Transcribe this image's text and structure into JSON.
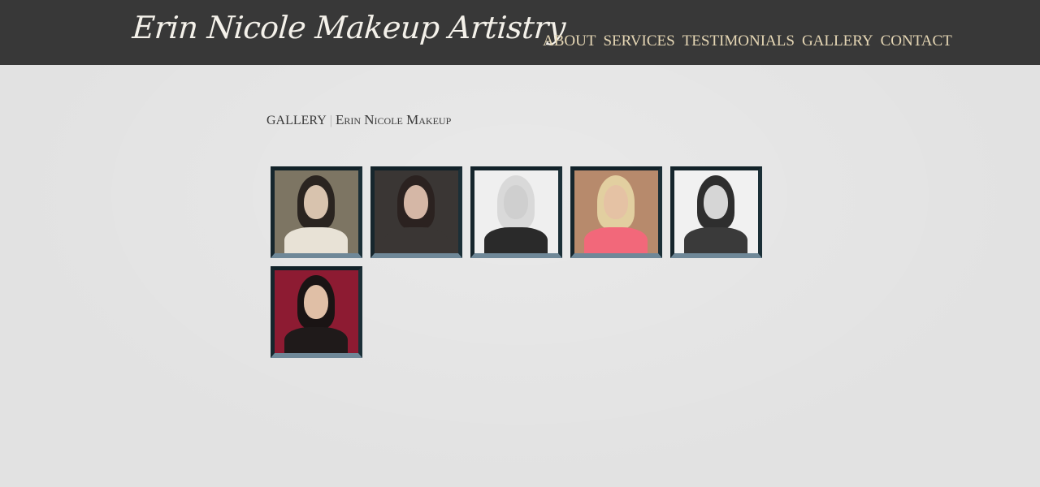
{
  "header": {
    "logo_text": "Erin Nicole Makeup Artistry",
    "nav": [
      {
        "label": "ABOUT"
      },
      {
        "label": "SERVICES"
      },
      {
        "label": "TESTIMONIALS"
      },
      {
        "label": "GALLERY"
      },
      {
        "label": "CONTACT"
      }
    ]
  },
  "page": {
    "section": "GALLERY",
    "separator": "|",
    "site_name": "Erin Nicole Makeup"
  },
  "gallery": {
    "photos": [
      {
        "name": "bride-portrait",
        "bg": "#7d7563",
        "hair": "#2a2420",
        "skin": "#d8c3ae",
        "body": "#e8e2d6"
      },
      {
        "name": "brunette-closeup",
        "bg": "#3a3634",
        "hair": "#2b2220",
        "skin": "#d5b7a6",
        "body": "#3a3634"
      },
      {
        "name": "blonde-bw-jacket",
        "bg": "#efefef",
        "hair": "#d9d9d9",
        "skin": "#cfcfcf",
        "body": "#2a2a2a"
      },
      {
        "name": "blonde-coral-top",
        "bg": "#b78a6c",
        "hair": "#e2cfa0",
        "skin": "#e5c2a4",
        "body": "#f2687a"
      },
      {
        "name": "curly-bw-portrait",
        "bg": "#f1f1f1",
        "hair": "#2e2e2e",
        "skin": "#d6d6d6",
        "body": "#3a3a3a"
      },
      {
        "name": "red-backdrop-portrait",
        "bg": "#8d1b32",
        "hair": "#1a1414",
        "skin": "#e0bfa6",
        "body": "#1f1a1a"
      }
    ]
  }
}
